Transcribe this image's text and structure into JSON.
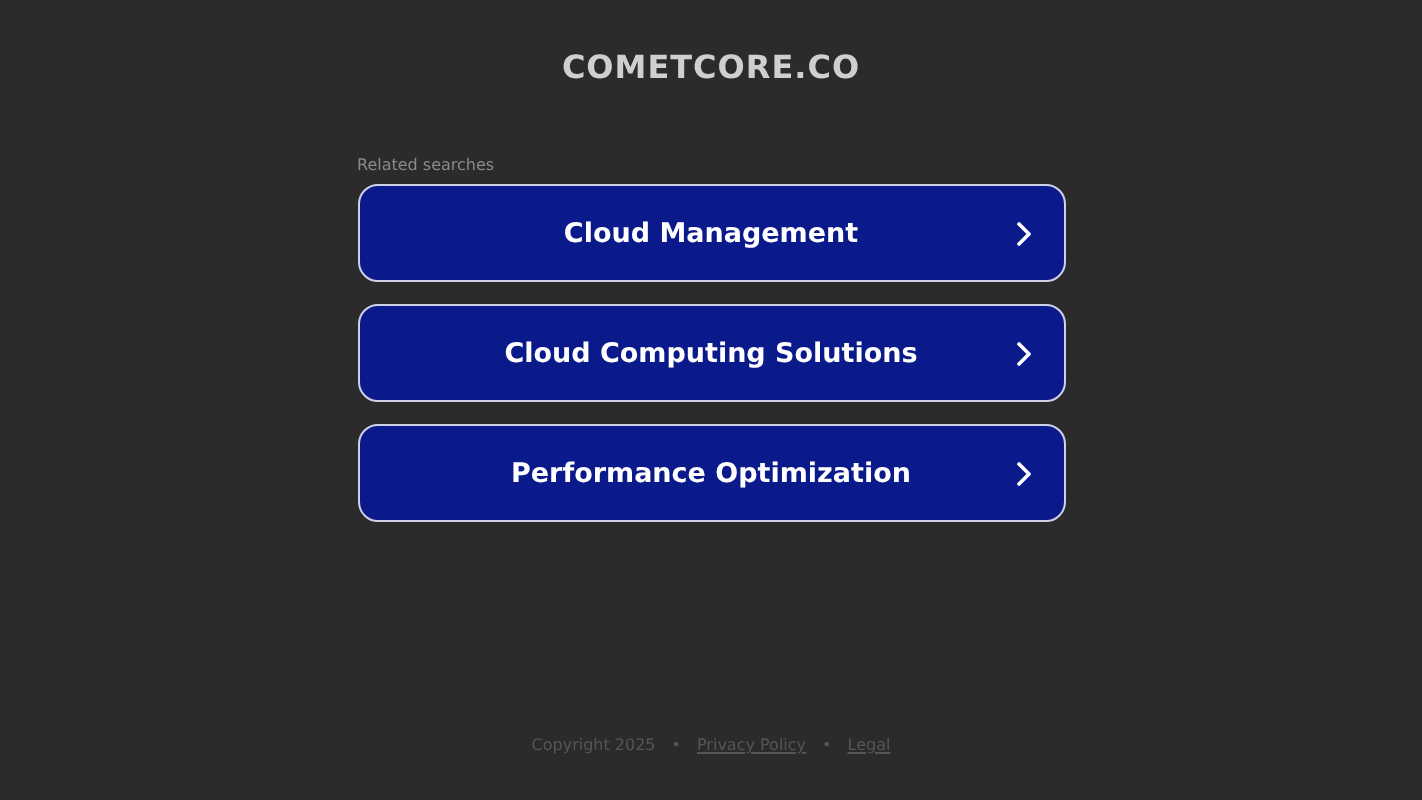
{
  "site_title": "COMETCORE.CO",
  "related_label": "Related searches",
  "links": [
    {
      "label": "Cloud Management"
    },
    {
      "label": "Cloud Computing Solutions"
    },
    {
      "label": "Performance Optimization"
    }
  ],
  "footer": [
    {
      "kind": "text",
      "text": "Copyright 2025"
    },
    {
      "kind": "sep",
      "text": "•"
    },
    {
      "kind": "link",
      "text": "Privacy Policy"
    },
    {
      "kind": "sep",
      "text": "•"
    },
    {
      "kind": "link",
      "text": "Legal"
    }
  ]
}
